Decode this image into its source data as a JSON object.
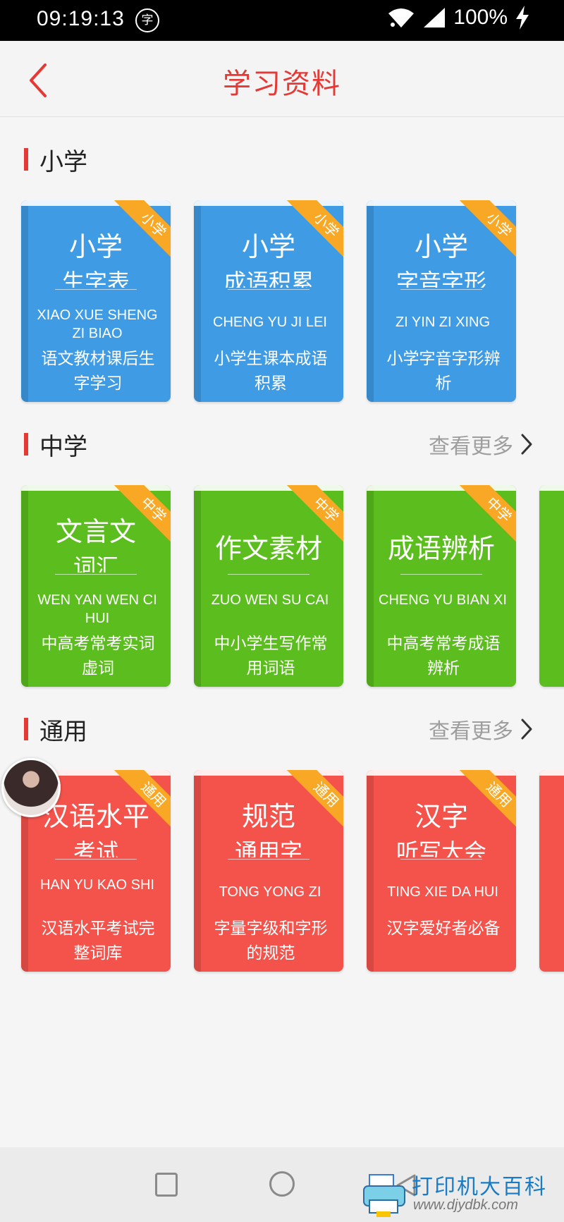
{
  "status_bar": {
    "time": "09:19:13",
    "app_icon_char": "字",
    "battery": "100%"
  },
  "header": {
    "title": "学习资料"
  },
  "sections": [
    {
      "title": "小学",
      "see_more": "",
      "books": [
        {
          "corner": "小学",
          "title_1": "小学",
          "title_2": "生字表",
          "pinyin": "XIAO XUE SHENG ZI BIAO",
          "desc": "语文教材课后生字学习",
          "color": "#3f9be4"
        },
        {
          "corner": "小学",
          "title_1": "小学",
          "title_2": "成语积累",
          "pinyin": "CHENG YU JI LEI",
          "desc": "小学生课本成语积累",
          "color": "#3f9be4"
        },
        {
          "corner": "小学",
          "title_1": "小学",
          "title_2": "字音字形",
          "pinyin": "ZI YIN ZI XING",
          "desc": "小学字音字形辨析",
          "color": "#3f9be4"
        }
      ]
    },
    {
      "title": "中学",
      "see_more": "查看更多",
      "books": [
        {
          "corner": "中学",
          "title_1": "文言文",
          "title_2": "词汇",
          "pinyin": "WEN YAN WEN CI HUI",
          "desc": "中高考常考实词虚词",
          "color": "#5bbd1e"
        },
        {
          "corner": "中学",
          "title_1": "作文素材",
          "title_2": "",
          "pinyin": "ZUO WEN SU CAI",
          "desc": "中小学生写作常用词语",
          "color": "#5bbd1e"
        },
        {
          "corner": "中学",
          "title_1": "成语辨析",
          "title_2": "",
          "pinyin": "CHENG YU BIAN XI",
          "desc": "中高考常考成语辨析",
          "color": "#5bbd1e"
        }
      ]
    },
    {
      "title": "通用",
      "see_more": "查看更多",
      "books": [
        {
          "corner": "通用",
          "title_1": "汉语水平",
          "title_2": "考试",
          "pinyin": "HAN YU KAO SHI",
          "desc": "汉语水平考试完整词库",
          "color": "#f4534c"
        },
        {
          "corner": "通用",
          "title_1": "规范",
          "title_2": "通用字",
          "pinyin": "TONG YONG ZI",
          "desc": "字量字级和字形的规范",
          "color": "#f4534c"
        },
        {
          "corner": "通用",
          "title_1": "汉字",
          "title_2": "听写大会",
          "pinyin": "TING XIE DA HUI",
          "desc": "汉字爱好者必备",
          "color": "#f4534c"
        }
      ]
    }
  ],
  "watermark": {
    "text": "打印机大百科",
    "url": "www.djydbk.com"
  }
}
